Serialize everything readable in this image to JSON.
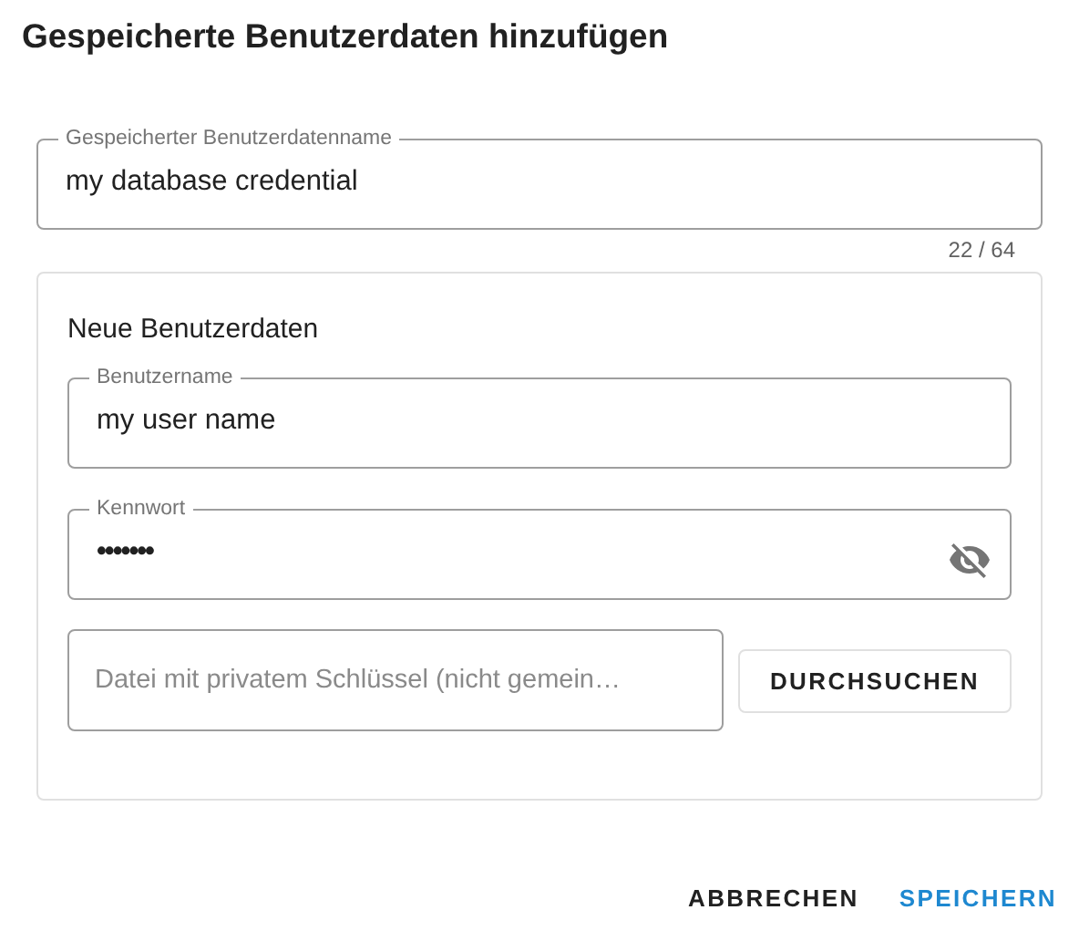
{
  "dialog": {
    "title": "Gespeicherte Benutzerdaten hinzufügen"
  },
  "name_field": {
    "label": "Gespeicherter Benutzerdatenname",
    "value": "my database credential",
    "counter": "22 / 64"
  },
  "credentials": {
    "heading": "Neue Benutzerdaten",
    "username": {
      "label": "Benutzername",
      "value": "my user name"
    },
    "password": {
      "label": "Kennwort",
      "value": "•••••••",
      "visible": false
    },
    "key_file": {
      "placeholder": "Datei mit privatem Schlüssel (nicht gemein…",
      "button": "DURCHSUCHEN"
    }
  },
  "actions": [
    {
      "label": "ABBRECHEN",
      "kind": "secondary"
    },
    {
      "label": "SPEICHERN",
      "kind": "primary"
    }
  ]
}
